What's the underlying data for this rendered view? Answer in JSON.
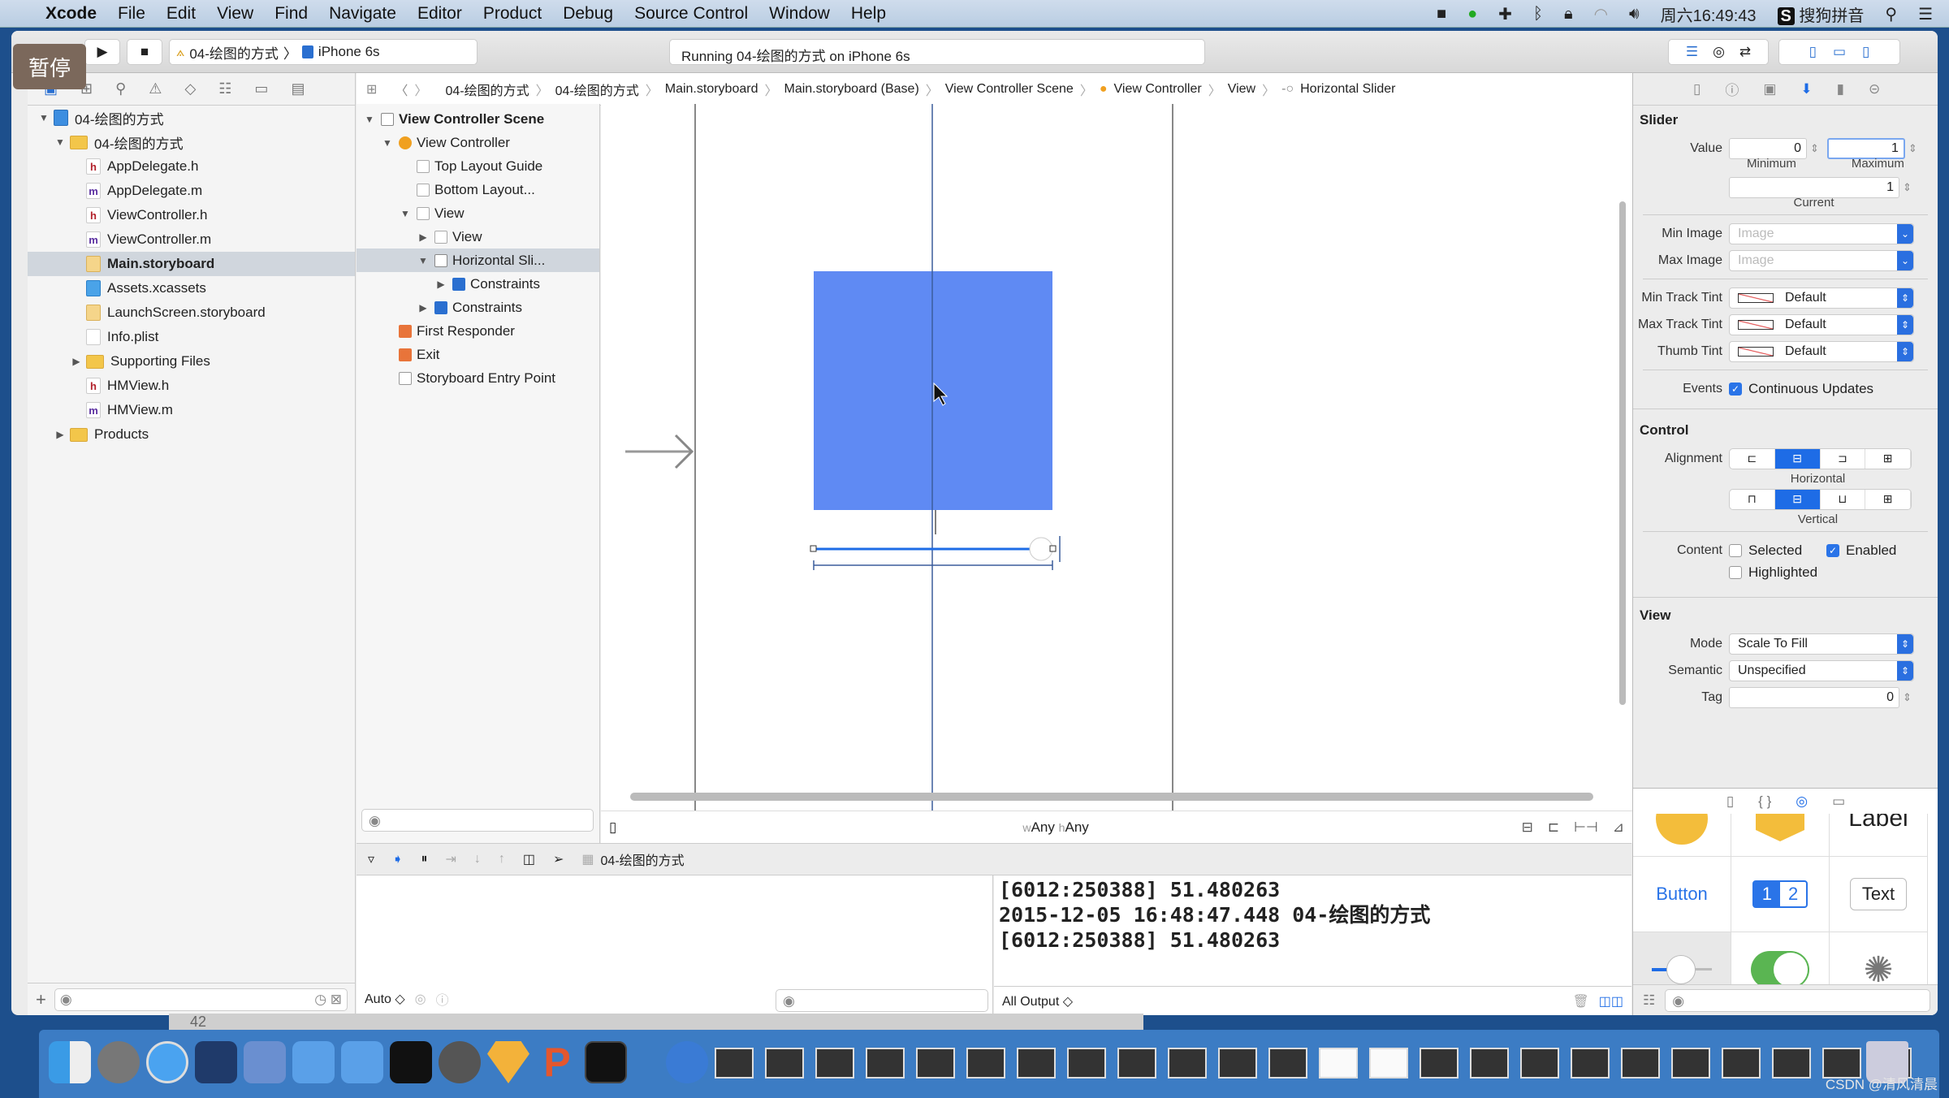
{
  "menubar": {
    "app": "Xcode",
    "items": [
      "File",
      "Edit",
      "View",
      "Find",
      "Navigate",
      "Editor",
      "Product",
      "Debug",
      "Source Control",
      "Window",
      "Help"
    ],
    "clock": "周六16:49:43",
    "input_method": "搜狗拼音"
  },
  "overlay": {
    "pause_label": "暂停"
  },
  "toolbar": {
    "scheme": "04-绘图的方式",
    "device": "iPhone 6s",
    "status": "Running 04-绘图的方式 on iPhone 6s"
  },
  "jumpbar": [
    "04-绘图的方式",
    "04-绘图的方式",
    "Main.storyboard",
    "Main.storyboard (Base)",
    "View Controller Scene",
    "View Controller",
    "View",
    "Horizontal Slider"
  ],
  "navigator": {
    "items": [
      {
        "label": "04-绘图的方式",
        "type": "proj",
        "level": 0,
        "disclosure": "▼"
      },
      {
        "label": "04-绘图的方式",
        "type": "folder",
        "level": 1,
        "disclosure": "▼"
      },
      {
        "label": "AppDelegate.h",
        "type": "h",
        "level": 2
      },
      {
        "label": "AppDelegate.m",
        "type": "m",
        "level": 2
      },
      {
        "label": "ViewController.h",
        "type": "h",
        "level": 2
      },
      {
        "label": "ViewController.m",
        "type": "m",
        "level": 2
      },
      {
        "label": "Main.storyboard",
        "type": "sb",
        "level": 2,
        "selected": true
      },
      {
        "label": "Assets.xcassets",
        "type": "assets",
        "level": 2
      },
      {
        "label": "LaunchScreen.storyboard",
        "type": "sb",
        "level": 2
      },
      {
        "label": "Info.plist",
        "type": "plist",
        "level": 2
      },
      {
        "label": "Supporting Files",
        "type": "folder",
        "level": 2,
        "disclosure": "▶"
      },
      {
        "label": "HMView.h",
        "type": "h",
        "level": 2
      },
      {
        "label": "HMView.m",
        "type": "m",
        "level": 2
      },
      {
        "label": "Products",
        "type": "folder",
        "level": 1,
        "disclosure": "▶"
      }
    ]
  },
  "outline": {
    "items": [
      {
        "label": "View Controller Scene",
        "level": 0,
        "disclosure": "▼",
        "bold": true
      },
      {
        "label": "View Controller",
        "level": 1,
        "disclosure": "▼"
      },
      {
        "label": "Top Layout Guide",
        "level": 2
      },
      {
        "label": "Bottom Layout...",
        "level": 2
      },
      {
        "label": "View",
        "level": 2,
        "disclosure": "▼"
      },
      {
        "label": "View",
        "level": 3,
        "disclosure": "▶"
      },
      {
        "label": "Horizontal Sli...",
        "level": 3,
        "disclosure": "▼",
        "selected": true
      },
      {
        "label": "Constraints",
        "level": 4,
        "disclosure": "▶"
      },
      {
        "label": "Constraints",
        "level": 3,
        "disclosure": "▶"
      },
      {
        "label": "First Responder",
        "level": 1
      },
      {
        "label": "Exit",
        "level": 1
      },
      {
        "label": "Storyboard Entry Point",
        "level": 1
      }
    ]
  },
  "canvas": {
    "size_class_w": "Any",
    "size_class_h": "Any",
    "view_color": "#5f8af3",
    "slider_value": 1.0
  },
  "inspector": {
    "slider": {
      "title": "Slider",
      "value_label": "Value",
      "minimum": "0",
      "maximum": "1",
      "current": "1",
      "min_caption": "Minimum",
      "max_caption": "Maximum",
      "current_caption": "Current",
      "min_image_label": "Min Image",
      "max_image_label": "Max Image",
      "image_placeholder": "Image",
      "min_track_label": "Min Track Tint",
      "max_track_label": "Max Track Tint",
      "thumb_label": "Thumb Tint",
      "tint_value": "Default",
      "events_label": "Events",
      "continuous_label": "Continuous Updates"
    },
    "control": {
      "title": "Control",
      "alignment_label": "Alignment",
      "horizontal_caption": "Horizontal",
      "vertical_caption": "Vertical",
      "content_label": "Content",
      "selected_label": "Selected",
      "enabled_label": "Enabled",
      "highlighted_label": "Highlighted"
    },
    "view": {
      "title": "View",
      "mode_label": "Mode",
      "mode_value": "Scale To Fill",
      "semantic_label": "Semantic",
      "semantic_value": "Unspecified",
      "tag_label": "Tag",
      "tag_value": "0"
    }
  },
  "library": {
    "label_item": "Label",
    "button_item": "Button",
    "seg_1": "1",
    "seg_2": "2",
    "text_item": "Text"
  },
  "debug": {
    "target": "04-绘图的方式",
    "auto_label": "Auto ◇",
    "output_filter": "All Output ◇"
  },
  "console": {
    "lines": [
      "[6012:250388] 51.480263",
      "2015-12-05 16:48:47.448 04-绘图的方式",
      "[6012:250388] 51.480263"
    ]
  },
  "dock": {
    "background_number": "42"
  },
  "watermark": "CSDN @清风清晨"
}
